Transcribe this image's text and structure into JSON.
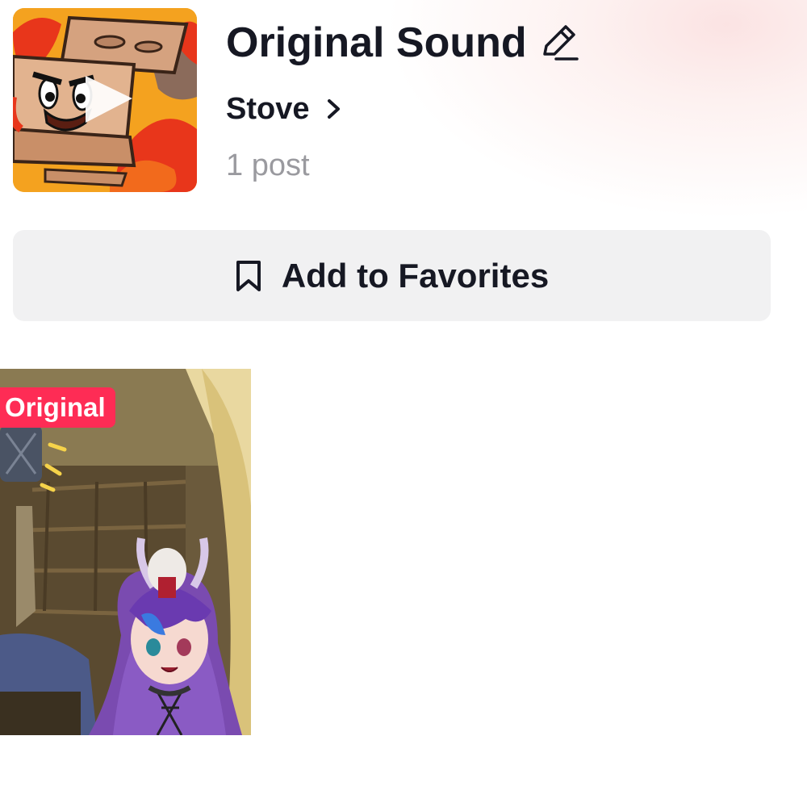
{
  "sound": {
    "title": "Original Sound",
    "author": "Stove",
    "post_count": "1 post"
  },
  "actions": {
    "favorite_label": "Add to Favorites"
  },
  "videos": [
    {
      "badge": "Original"
    }
  ],
  "icons": {
    "edit": "pencil-icon",
    "author_link": "chevron-right-icon",
    "favorite": "bookmark-icon",
    "cover_play": "play-icon"
  },
  "colors": {
    "badge_bg": "#fe2c55",
    "button_bg": "#f1f1f2",
    "muted_text": "#9a9a9f"
  }
}
